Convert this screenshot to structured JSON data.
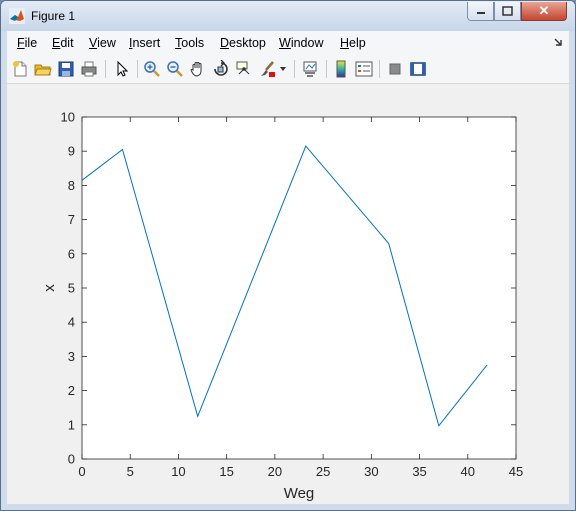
{
  "window": {
    "title": "Figure 1"
  },
  "controls": {
    "minimize": "▭",
    "maximize": "□",
    "close": "✕"
  },
  "menu": [
    {
      "label": "File",
      "accel": "F",
      "rest": "ile"
    },
    {
      "label": "Edit",
      "accel": "E",
      "rest": "dit"
    },
    {
      "label": "View",
      "accel": "V",
      "rest": "iew"
    },
    {
      "label": "Insert",
      "accel": "I",
      "rest": "nsert"
    },
    {
      "label": "Tools",
      "accel": "T",
      "rest": "ools"
    },
    {
      "label": "Desktop",
      "accel": "D",
      "rest": "esktop"
    },
    {
      "label": "Window",
      "accel": "W",
      "rest": "indow"
    },
    {
      "label": "Help",
      "accel": "H",
      "rest": "elp"
    }
  ],
  "toolbar": {
    "icons": [
      "new-figure-icon",
      "open-file-icon",
      "save-icon",
      "print-icon",
      "edit-plot-arrow-icon",
      "zoom-in-icon",
      "zoom-out-icon",
      "pan-hand-icon",
      "rotate-3d-icon",
      "data-cursor-icon",
      "brush-icon",
      "link-plot-icon",
      "insert-colorbar-icon",
      "insert-legend-icon",
      "hide-plot-tools-icon",
      "show-plot-tools-icon"
    ]
  },
  "colors": {
    "line": "#0072bd",
    "axes_bg": "#ffffff",
    "figure_bg": "#f0f0f0"
  },
  "chart_data": {
    "type": "line",
    "xlabel": "Weg",
    "ylabel": "x",
    "xlim": [
      0,
      45
    ],
    "ylim": [
      0,
      10
    ],
    "x_ticks": [
      "0",
      "5",
      "10",
      "15",
      "20",
      "25",
      "30",
      "35",
      "40",
      "45"
    ],
    "y_ticks": [
      "0",
      "1",
      "2",
      "3",
      "4",
      "5",
      "6",
      "7",
      "8",
      "9",
      "10"
    ],
    "grid": false,
    "series": [
      {
        "x": [
          0,
          4.2,
          12,
          23.2,
          31.8,
          37,
          42
        ],
        "y": [
          8.15,
          9.05,
          1.25,
          9.15,
          6.3,
          0.97,
          2.75
        ]
      }
    ]
  }
}
